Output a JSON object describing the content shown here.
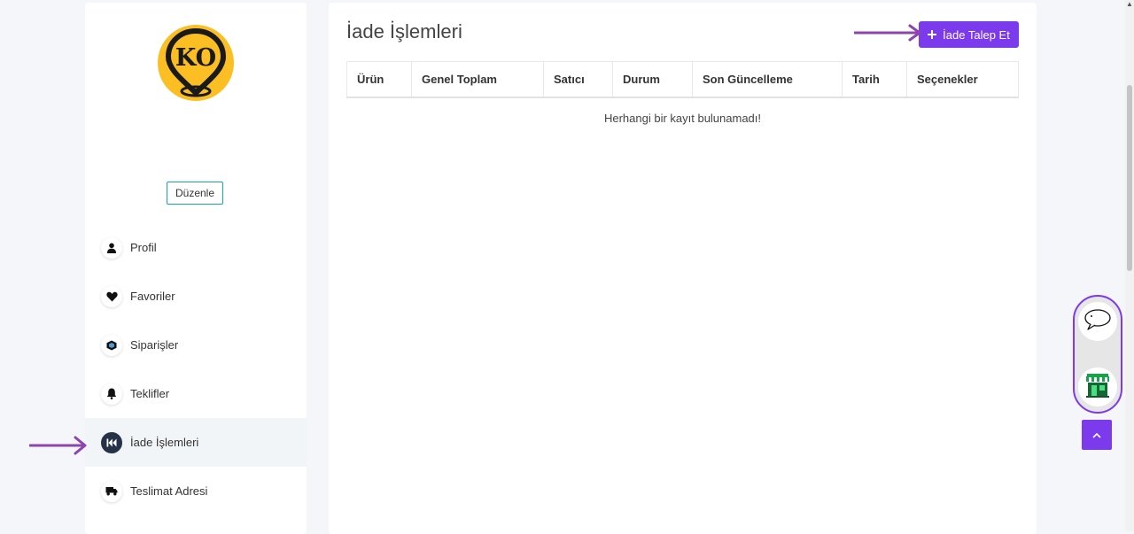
{
  "sidebar": {
    "logo_text": "KO",
    "edit_label": "Düzenle",
    "items": [
      {
        "label": "Profil",
        "icon": "user-icon"
      },
      {
        "label": "Favoriler",
        "icon": "heart-icon"
      },
      {
        "label": "Siparişler",
        "icon": "box-icon"
      },
      {
        "label": "Teklifler",
        "icon": "bell-icon"
      },
      {
        "label": "İade İşlemleri",
        "icon": "rewind-icon",
        "active": true
      },
      {
        "label": "Teslimat Adresi",
        "icon": "truck-icon"
      }
    ]
  },
  "main": {
    "title": "İade İşlemleri",
    "request_button": "İade Talep Et",
    "columns": [
      "Ürün",
      "Genel Toplam",
      "Satıcı",
      "Durum",
      "Son Güncelleme",
      "Tarih",
      "Seçenekler"
    ],
    "empty_message": "Herhangi bir kayıt bulunamadı!"
  },
  "colors": {
    "accent": "#7c3aed",
    "logo_yellow": "#fbbf24",
    "active_icon_bg": "#253147",
    "edit_border": "#17a2b8"
  }
}
